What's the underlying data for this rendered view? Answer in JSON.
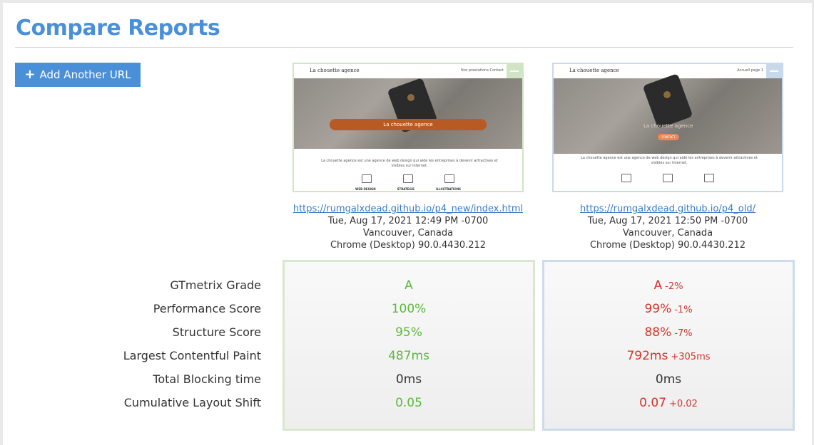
{
  "page": {
    "title": "Compare Reports"
  },
  "toolbar": {
    "add_url_label": "Add Another URL",
    "add_icon": "plus-icon"
  },
  "colors": {
    "accent": "#4a90d9",
    "good": "#5cb83c",
    "bad": "#d0352b",
    "report_a_border": "#cfe5c4",
    "report_b_border": "#c9d9ec"
  },
  "metric_labels": [
    "GTmetrix Grade",
    "Performance Score",
    "Structure Score",
    "Largest Contentful Paint",
    "Total Blocking time",
    "Cumulative Layout Shift"
  ],
  "reports": [
    {
      "url": "https://rumgalxdead.github.io/p4_new/index.html",
      "date": "Tue, Aug 17, 2021 12:49 PM -0700",
      "location": "Vancouver, Canada",
      "browser": "Chrome (Desktop) 90.0.4430.212",
      "thumb": {
        "logo": "La chouette agence",
        "nav": "Nos prestations   Contact",
        "banner": "La chouette agence",
        "desc": "La chouette agence est une agence de web design qui aide les entreprises à devenir attractives et visibles sur Internet.",
        "services": [
          "WEB DESIGN",
          "STRATEGIE",
          "ILLUSTRATIONS"
        ]
      },
      "values": [
        {
          "value": "A",
          "delta": ""
        },
        {
          "value": "100%",
          "delta": ""
        },
        {
          "value": "95%",
          "delta": ""
        },
        {
          "value": "487ms",
          "delta": ""
        },
        {
          "value": "0ms",
          "delta": ""
        },
        {
          "value": "0.05",
          "delta": ""
        }
      ]
    },
    {
      "url": "https://rumgalxdead.github.io/p4_old/",
      "date": "Tue, Aug 17, 2021 12:50 PM -0700",
      "location": "Vancouver, Canada",
      "browser": "Chrome (Desktop) 90.0.4430.212",
      "thumb": {
        "logo": "La chouette agence",
        "nav": "Accueil   page 1",
        "banner": "La chouette agence",
        "button": "CONTACT",
        "desc": "La chouette agence est une agence de web design qui aide les entreprises à devenir attractives et visibles sur Internet."
      },
      "values": [
        {
          "value": "A",
          "delta": "-2%"
        },
        {
          "value": "99%",
          "delta": "-1%"
        },
        {
          "value": "88%",
          "delta": "-7%"
        },
        {
          "value": "792ms",
          "delta": "+305ms"
        },
        {
          "value": "0ms",
          "delta": ""
        },
        {
          "value": "0.07",
          "delta": "+0.02"
        }
      ]
    }
  ]
}
